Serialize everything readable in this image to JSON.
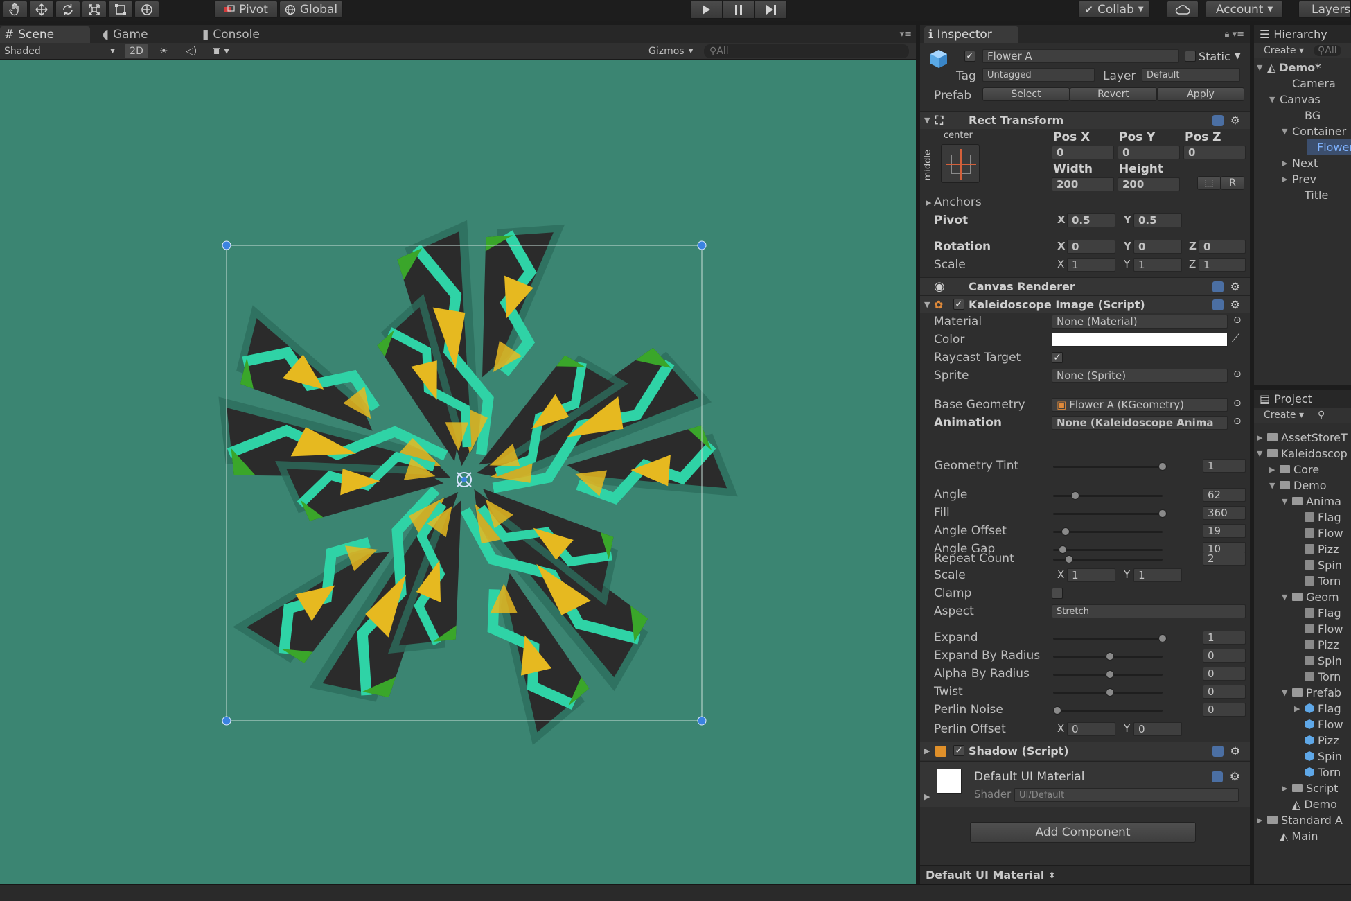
{
  "toolbar": {
    "pivot": "Pivot",
    "global": "Global",
    "collab": "Collab",
    "account": "Account",
    "layers": "Layers"
  },
  "scene_tabs": {
    "scene": "Scene",
    "game": "Game",
    "console": "Console"
  },
  "scene_bar": {
    "shading": "Shaded",
    "mode_2d": "2D",
    "gizmos": "Gizmos",
    "search_placeholder": "All"
  },
  "inspector": {
    "tab": "Inspector",
    "object_name": "Flower A",
    "static": "Static",
    "tag_label": "Tag",
    "tag": "Untagged",
    "layer_label": "Layer",
    "layer": "Default",
    "prefab_label": "Prefab",
    "prefab_select": "Select",
    "prefab_revert": "Revert",
    "prefab_apply": "Apply",
    "rect_transform": {
      "title": "Rect Transform",
      "anchor_h": "center",
      "anchor_v": "middle",
      "pos_x_label": "Pos X",
      "pos_y_label": "Pos Y",
      "pos_z_label": "Pos Z",
      "pos_x": "0",
      "pos_y": "0",
      "pos_z": "0",
      "width_label": "Width",
      "height_label": "Height",
      "width": "200",
      "height": "200",
      "r_button": "R",
      "anchors": "Anchors",
      "pivot_label": "Pivot",
      "pivot_x": "0.5",
      "pivot_y": "0.5",
      "rotation_label": "Rotation",
      "rot_x": "0",
      "rot_y": "0",
      "rot_z": "0",
      "scale_label": "Scale",
      "scale_x": "1",
      "scale_y": "1",
      "scale_z": "1",
      "axis_x": "X",
      "axis_y": "Y",
      "axis_z": "Z"
    },
    "canvas_renderer": "Canvas Renderer",
    "kaleidoscope": {
      "title": "Kaleidoscope Image (Script)",
      "material_label": "Material",
      "material": "None (Material)",
      "color_label": "Color",
      "raycast_label": "Raycast Target",
      "sprite_label": "Sprite",
      "sprite": "None (Sprite)",
      "base_geometry_label": "Base Geometry",
      "base_geometry": "Flower A (KGeometry)",
      "animation_label": "Animation",
      "animation": "None (Kaleidoscope Anima",
      "sliders": [
        {
          "label": "Geometry Tint",
          "value": "1",
          "pos": 1.0
        },
        {
          "label": "Angle",
          "value": "62",
          "pos": 0.17
        },
        {
          "label": "Fill",
          "value": "360",
          "pos": 1.0
        },
        {
          "label": "Angle Offset",
          "value": "19",
          "pos": 0.08
        },
        {
          "label": "Angle Gap",
          "value": "10",
          "pos": 0.05
        },
        {
          "label": "Repeat Count",
          "value": "2",
          "pos": 0.11
        },
        {
          "label": "Expand",
          "value": "1",
          "pos": 1.0
        },
        {
          "label": "Expand By Radius",
          "value": "0",
          "pos": 0.5
        },
        {
          "label": "Alpha By Radius",
          "value": "0",
          "pos": 0.5
        },
        {
          "label": "Twist",
          "value": "0",
          "pos": 0.5
        },
        {
          "label": "Perlin Noise",
          "value": "0",
          "pos": 0.0
        }
      ],
      "scale_label": "Scale",
      "scale_x": "1",
      "scale_y": "1",
      "clamp_label": "Clamp",
      "aspect_label": "Aspect",
      "aspect": "Stretch",
      "perlin_offset_label": "Perlin Offset",
      "perlin_x": "0",
      "perlin_y": "0"
    },
    "shadow": "Shadow (Script)",
    "material_name": "Default UI Material",
    "shader_label": "Shader",
    "shader": "UI/Default",
    "add_component": "Add Component",
    "footer": "Default UI Material"
  },
  "hierarchy": {
    "tab": "Hierarchy",
    "create": "Create",
    "search": "All",
    "items": [
      {
        "label": "Demo*",
        "indent": 0,
        "arrow": "▼",
        "bold": true
      },
      {
        "label": "Camera",
        "indent": 2,
        "arrow": ""
      },
      {
        "label": "Canvas",
        "indent": 1,
        "arrow": "▼"
      },
      {
        "label": "BG",
        "indent": 3,
        "arrow": ""
      },
      {
        "label": "Container",
        "indent": 2,
        "arrow": "▼"
      },
      {
        "label": "Flower",
        "indent": 4,
        "arrow": "",
        "selected": true
      },
      {
        "label": "Next",
        "indent": 2,
        "arrow": "▶"
      },
      {
        "label": "Prev",
        "indent": 2,
        "arrow": "▶"
      },
      {
        "label": "Title",
        "indent": 3,
        "arrow": ""
      }
    ]
  },
  "project": {
    "tab": "Project",
    "create": "Create",
    "items": [
      {
        "label": "AssetStoreT",
        "indent": 0,
        "arrow": "▶",
        "icon": "folder"
      },
      {
        "label": "Kaleidoscop",
        "indent": 0,
        "arrow": "▼",
        "icon": "folder"
      },
      {
        "label": "Core",
        "indent": 1,
        "arrow": "▶",
        "icon": "folder"
      },
      {
        "label": "Demo",
        "indent": 1,
        "arrow": "▼",
        "icon": "folder"
      },
      {
        "label": "Anima",
        "indent": 2,
        "arrow": "▼",
        "icon": "folder"
      },
      {
        "label": "Flag",
        "indent": 3,
        "arrow": "",
        "icon": "anim"
      },
      {
        "label": "Flow",
        "indent": 3,
        "arrow": "",
        "icon": "anim"
      },
      {
        "label": "Pizz",
        "indent": 3,
        "arrow": "",
        "icon": "anim"
      },
      {
        "label": "Spin",
        "indent": 3,
        "arrow": "",
        "icon": "anim"
      },
      {
        "label": "Torn",
        "indent": 3,
        "arrow": "",
        "icon": "anim"
      },
      {
        "label": "Geom",
        "indent": 2,
        "arrow": "▼",
        "icon": "folder"
      },
      {
        "label": "Flag",
        "indent": 3,
        "arrow": "",
        "icon": "anim"
      },
      {
        "label": "Flow",
        "indent": 3,
        "arrow": "",
        "icon": "anim"
      },
      {
        "label": "Pizz",
        "indent": 3,
        "arrow": "",
        "icon": "anim"
      },
      {
        "label": "Spin",
        "indent": 3,
        "arrow": "",
        "icon": "anim"
      },
      {
        "label": "Torn",
        "indent": 3,
        "arrow": "",
        "icon": "anim"
      },
      {
        "label": "Prefab",
        "indent": 2,
        "arrow": "▼",
        "icon": "folder"
      },
      {
        "label": "Flag",
        "indent": 3,
        "arrow": "▶",
        "icon": "prefab"
      },
      {
        "label": "Flow",
        "indent": 3,
        "arrow": "",
        "icon": "prefab"
      },
      {
        "label": "Pizz",
        "indent": 3,
        "arrow": "",
        "icon": "prefab"
      },
      {
        "label": "Spin",
        "indent": 3,
        "arrow": "",
        "icon": "prefab"
      },
      {
        "label": "Torn",
        "indent": 3,
        "arrow": "",
        "icon": "prefab"
      },
      {
        "label": "Script",
        "indent": 2,
        "arrow": "▶",
        "icon": "folder"
      },
      {
        "label": "Demo",
        "indent": 2,
        "arrow": "",
        "icon": "unity"
      },
      {
        "label": "Standard A",
        "indent": 0,
        "arrow": "▶",
        "icon": "folder"
      },
      {
        "label": "Main",
        "indent": 1,
        "arrow": "",
        "icon": "unity"
      }
    ]
  },
  "colors": {
    "scene_bg": "#3b8572",
    "petal_dark": "#2b2b2b",
    "teal": "#2fd3a6",
    "yellow": "#e6b920",
    "green": "#3aa62a",
    "selection_blue": "#3b83e0"
  },
  "icons": [
    "hand-icon",
    "move-icon",
    "rotate-icon",
    "scale-icon",
    "rect-icon",
    "transform-icon",
    "play-icon",
    "pause-icon",
    "step-icon",
    "cloud-icon",
    "cube-icon",
    "gear-icon",
    "eye-icon"
  ]
}
